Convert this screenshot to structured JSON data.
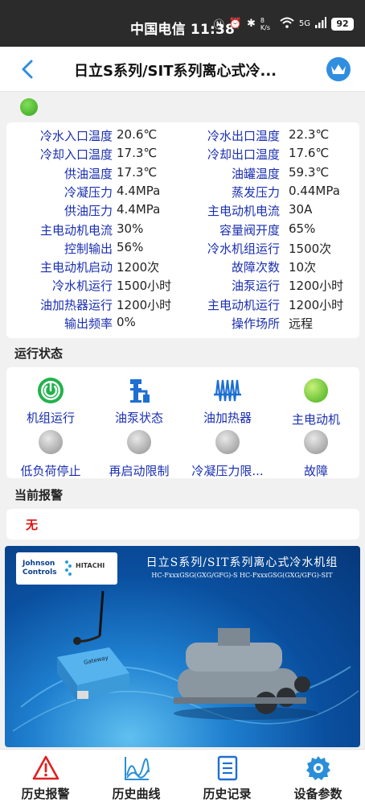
{
  "statusbar": {
    "time": "中国电信 11:38",
    "network": "5G",
    "speed": "8 K/s",
    "battery": "92"
  },
  "header": {
    "title": "日立S系列/SIT系列离心式冷水机组",
    "title_display": "日立S系列/SIT系列离心式冷..."
  },
  "params": [
    {
      "l1": "冷水入口温度",
      "v1": "20.6℃",
      "l2": "冷水出口温度",
      "v2": "22.3℃"
    },
    {
      "l1": "冷却入口温度",
      "v1": "17.3℃",
      "l2": "冷却出口温度",
      "v2": "17.6℃"
    },
    {
      "l1": "供油温度",
      "v1": "17.3℃",
      "l2": "油罐温度",
      "v2": "59.3℃"
    },
    {
      "l1": "冷凝压力",
      "v1": "4.4MPa",
      "l2": "蒸发压力",
      "v2": "0.44MPa"
    },
    {
      "l1": "供油压力",
      "v1": "4.4MPa",
      "l2": "主电动机电流",
      "v2": "30A"
    },
    {
      "l1": "主电动机电流",
      "v1": "30%",
      "l2": "容量阀开度",
      "v2": "65%"
    },
    {
      "l1": "控制输出",
      "v1": "56%",
      "l2": "冷水机组运行",
      "v2": "1500次"
    },
    {
      "l1": "主电动机启动",
      "v1": "1200次",
      "l2": "故障次数",
      "v2": "10次"
    },
    {
      "l1": "冷水机运行",
      "v1": "1500小时",
      "l2": "油泵运行",
      "v2": "1200小时"
    },
    {
      "l1": "油加热器运行",
      "v1": "1200小时",
      "l2": "主电动机运行",
      "v2": "1200小时"
    },
    {
      "l1": "输出频率",
      "v1": "0%",
      "l2": "操作场所",
      "v2": "远程"
    }
  ],
  "run_status": {
    "title": "运行状态",
    "items": [
      {
        "label": "机组运行",
        "icon": "power-on-icon"
      },
      {
        "label": "油泵状态",
        "icon": "oil-pump-icon"
      },
      {
        "label": "油加热器",
        "icon": "heater-icon"
      },
      {
        "label": "主电动机",
        "icon": "motor-status-icon"
      },
      {
        "label": "低负荷停止",
        "icon": "status-ball-icon"
      },
      {
        "label": "再启动限制",
        "icon": "status-ball-icon"
      },
      {
        "label": "冷凝压力限...",
        "icon": "status-ball-icon"
      },
      {
        "label": "故障",
        "icon": "status-ball-icon"
      }
    ]
  },
  "alarm": {
    "title": "当前报警",
    "text": "无"
  },
  "banner": {
    "logo_left": "Johnson Controls",
    "logo_right": "HITACHI",
    "title": "日立S系列/SIT系列离心式冷水机组",
    "subtitle": "HC-FxxxGSG(GXG/GFG)-S HC-FxxxGSG(GXG/GFG)-SIT",
    "device_label": "Gateway"
  },
  "nav": [
    {
      "label": "历史报警",
      "icon": "alarm-warning-icon"
    },
    {
      "label": "历史曲线",
      "icon": "history-chart-icon"
    },
    {
      "label": "历史记录",
      "icon": "history-record-icon"
    },
    {
      "label": "设备参数",
      "icon": "settings-gear-icon"
    }
  ],
  "colors": {
    "label_blue": "#1a2fb0",
    "accent_blue": "#2f8ee0",
    "alarm_red": "#e01010",
    "status_green": "#3aa01f"
  }
}
